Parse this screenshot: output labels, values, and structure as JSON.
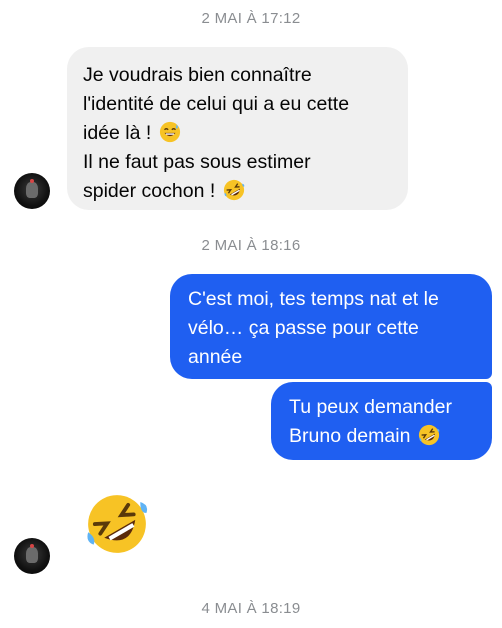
{
  "timestamps": [
    "2 MAI À 17:12",
    "2 MAI À 18:16",
    "4 MAI À 18:19"
  ],
  "messages": [
    {
      "direction": "incoming",
      "lines": [
        "Je voudrais bien connaître",
        "l'identité de celui qui a eu cette",
        "idée là !",
        "Il ne faut pas sous estimer",
        "spider cochon !"
      ],
      "emojis": [
        "sweat-smile-emoji",
        "rofl-emoji"
      ]
    },
    {
      "direction": "outgoing",
      "lines": [
        "C'est moi, tes temps nat et le",
        "vélo… ça passe pour cette",
        "année"
      ]
    },
    {
      "direction": "outgoing",
      "lines": [
        "Tu peux demander",
        "Bruno demain"
      ],
      "emojis": [
        "rofl-emoji"
      ]
    },
    {
      "direction": "incoming",
      "type": "emoji-only",
      "emoji": "rofl-emoji"
    }
  ],
  "colors": {
    "outgoing_bubble": "#1f5ff1",
    "incoming_bubble": "#f0f0f0",
    "timestamp": "#8a8d91"
  }
}
